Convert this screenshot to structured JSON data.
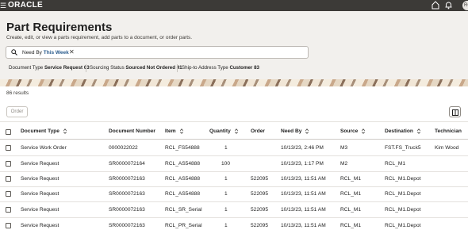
{
  "topbar": {
    "brand": "ORACLE",
    "menu_glyph": "☰",
    "avatar_text": "RC",
    "icons": [
      "hamburger-icon",
      "home-icon",
      "bell-icon"
    ]
  },
  "header": {
    "title": "Part Requirements",
    "subtitle": "Create, edit, or view a parts requirement, add parts to a document, or order parts."
  },
  "search": {
    "filter_label": "Need By",
    "filter_value": "This Week",
    "close_glyph": "✕"
  },
  "facets": [
    {
      "label": "Document Type",
      "value": "Service Request",
      "count": "63"
    },
    {
      "label": "Sourcing Status",
      "value": "Sourced Not Ordered",
      "count": "41"
    },
    {
      "label": "Ship-to Address Type",
      "value": "Customer",
      "count": "83"
    }
  ],
  "results": {
    "count_text": "86 results"
  },
  "toolbar": {
    "order_label": "Order"
  },
  "table": {
    "columns": [
      {
        "label": "Document Type",
        "sortable": true
      },
      {
        "label": "Document Number",
        "sortable": false
      },
      {
        "label": "Item",
        "sortable": true
      },
      {
        "label": "Quantity",
        "sortable": true
      },
      {
        "label": "Order",
        "sortable": false
      },
      {
        "label": "Need By",
        "sortable": true
      },
      {
        "label": "Source",
        "sortable": true
      },
      {
        "label": "Destination",
        "sortable": true
      },
      {
        "label": "Technician",
        "sortable": false
      }
    ],
    "rows": [
      {
        "doc_type": "Service Work Order",
        "doc_number": "0000022022",
        "item": "RCL_FS54888",
        "quantity": "1",
        "order": "",
        "need_by": "10/13/23, 2:46 PM",
        "source": "M3",
        "destination": "FST.FS_Truck5",
        "technician": "Kim Wood"
      },
      {
        "doc_type": "Service Request",
        "doc_number": "SR0000072164",
        "item": "RCL_AS54888",
        "quantity": "100",
        "order": "",
        "need_by": "10/13/23, 1:17 PM",
        "source": "M2",
        "destination": "RCL_M1",
        "technician": ""
      },
      {
        "doc_type": "Service Request",
        "doc_number": "SR0000072163",
        "item": "RCL_AS54888",
        "quantity": "1",
        "order": "522095",
        "need_by": "10/13/23, 11:51 AM",
        "source": "RCL_M1",
        "destination": "RCL_M1.Depot",
        "technician": ""
      },
      {
        "doc_type": "Service Request",
        "doc_number": "SR0000072163",
        "item": "RCL_AS54888",
        "quantity": "1",
        "order": "522095",
        "need_by": "10/13/23, 11:51 AM",
        "source": "RCL_M1",
        "destination": "RCL_M1.Depot",
        "technician": ""
      },
      {
        "doc_type": "Service Request",
        "doc_number": "SR0000072163",
        "item": "RCL_SR_Serial",
        "quantity": "1",
        "order": "522095",
        "need_by": "10/13/23, 11:51 AM",
        "source": "RCL_M1",
        "destination": "RCL_M1.Depot",
        "technician": ""
      },
      {
        "doc_type": "Service Request",
        "doc_number": "SR0000072163",
        "item": "RCL_PR_Serial",
        "quantity": "1",
        "order": "522095",
        "need_by": "10/13/23, 11:51 AM",
        "source": "RCL_M1",
        "destination": "RCL_M1.Depot",
        "technician": ""
      }
    ]
  },
  "colors": {
    "topbar": "#3c3a37",
    "header_bg": "#f2f0ed",
    "filter_value": "#2a5b8c"
  }
}
